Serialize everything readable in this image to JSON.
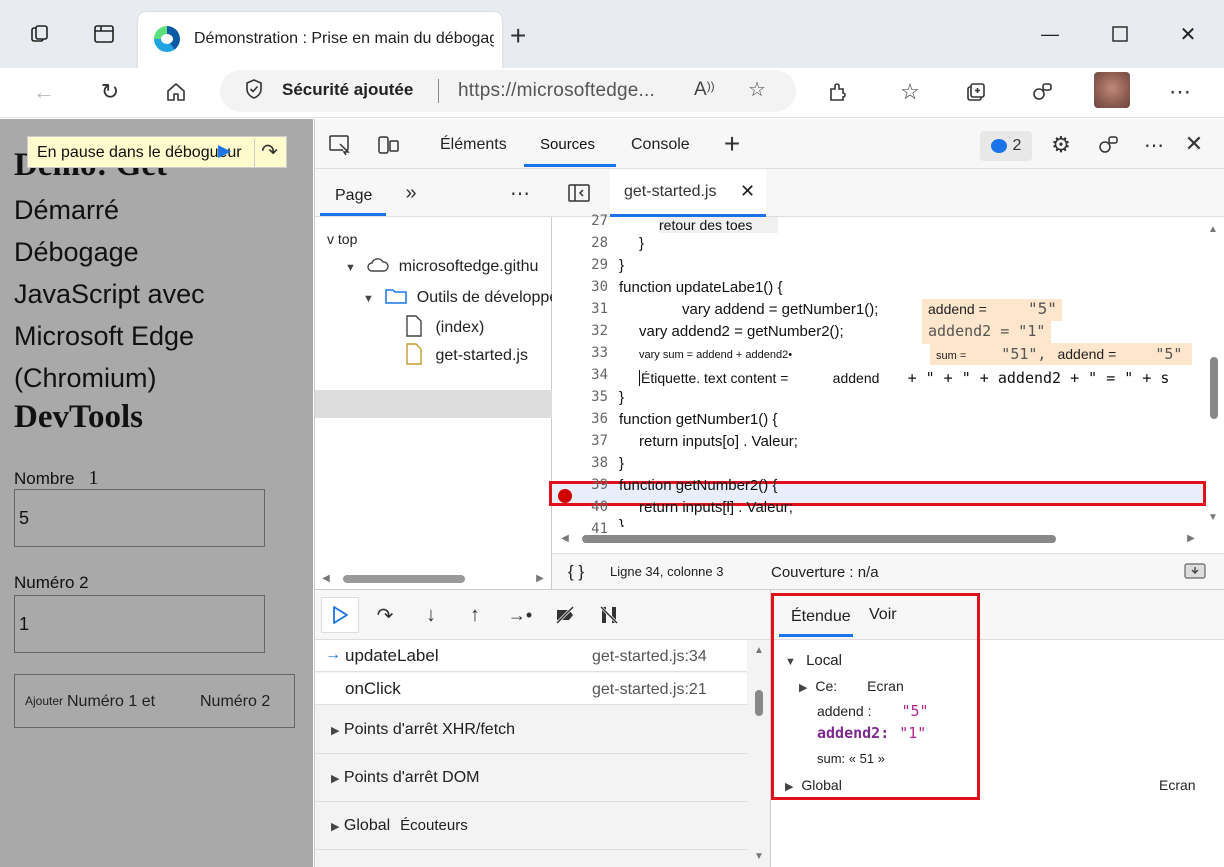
{
  "browser": {
    "tab_title": "Démonstration : Prise en main du débogage",
    "security_label": "Sécurité ajoutée",
    "url": "https://microsoftedge..."
  },
  "page": {
    "paused_message": "En pause dans le débogueur",
    "heading_partial": "Demo: Get",
    "lines": [
      "Démarré",
      "Débogage",
      "JavaScript avec",
      "Microsoft Edge",
      "(Chromium)"
    ],
    "heading2": "DevTools",
    "label1": "Nombre",
    "label1_suffix": "1",
    "input1_value": "5",
    "label2": "Numéro 2",
    "input2_value": "1",
    "button_prefix": "Ajouter",
    "button_label": "Numéro 1 et",
    "button_label2": "Numéro 2"
  },
  "devtools": {
    "tabs": {
      "elements": "Éléments",
      "sources": "Sources",
      "console": "Console"
    },
    "issues_count": "2",
    "navigator": {
      "tab": "Page",
      "top": "v top",
      "domain": "microsoftedge.githu",
      "folder": "Outils de développement",
      "files": [
        "(index)",
        "get-started.js"
      ]
    },
    "editor": {
      "file_tab": "get-started.js",
      "line_numbers": [
        "27",
        "28",
        "29",
        "30",
        "31",
        "32",
        "33",
        "34",
        "35",
        "36",
        "37",
        "38",
        "39",
        "40",
        "41"
      ],
      "lines": {
        "l27": "retour des toes",
        "l28": "}",
        "l29": "}",
        "l30": "function updateLabe1() {",
        "l31": "vary addend = getNumber1();",
        "l32": "vary addend2 = getNumber2();",
        "l33": "vary sum = addend + addend2•",
        "l34a": "Étiquette. text content =",
        "l34b": "addend",
        "l34c": "+ \" + \" + addend2 + \" = \" + s",
        "l35": "}",
        "l36": "function getNumber1() {",
        "l37": "return inputs[o] . Valeur;",
        "l38": "}",
        "l39": "function getNumber2() {",
        "l40": "return inputs[l] . Valeur;",
        "l41": "}"
      },
      "inline_values": {
        "v31a": "addend =",
        "v31b": "\"5\"",
        "v32": "addend2 = \"1\"",
        "v33a": "sum =",
        "v33b": "\"51\",",
        "v33c": "addend =",
        "v33d": "\"5\""
      }
    },
    "status": {
      "braces": "{ }",
      "position": "Ligne 34, colonne 3",
      "coverage": "Couverture : n/a"
    },
    "call_stack": [
      {
        "fn": "updateLabel",
        "loc": "get-started.js:34"
      },
      {
        "fn": "onClick",
        "loc": "get-started.js:21"
      }
    ],
    "sections": [
      "Points d'arrêt XHR/fetch",
      "Points d'arrêt DOM",
      "Global"
    ],
    "global_listeners": "Écouteurs",
    "scope": {
      "tabs": [
        "Étendue",
        "Voir"
      ],
      "local": "Local",
      "this_key": "Ce:",
      "this_val": "Ecran",
      "addend_key": "addend :",
      "addend_val": "\"5\"",
      "addend2_key": "addend2:",
      "addend2_val": "\"1\"",
      "sum": "sum: « 51 »",
      "global": "Global",
      "global_val": "Ecran"
    }
  }
}
